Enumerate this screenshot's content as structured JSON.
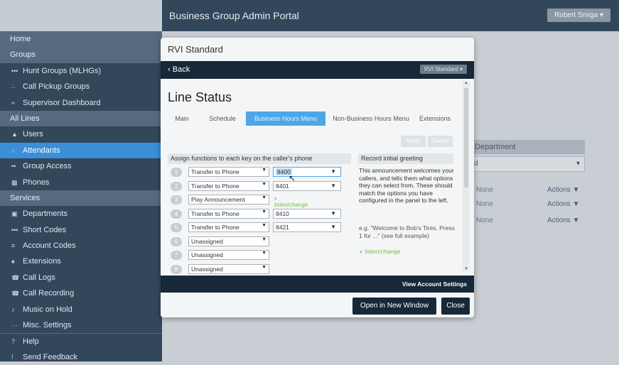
{
  "topbar": {
    "title": "Business Group Admin Portal",
    "user": "Robert Smiga ▾"
  },
  "sidebar": {
    "items": [
      {
        "label": "Home",
        "type": "hdr",
        "icon": ""
      },
      {
        "label": "Groups",
        "type": "hdr",
        "icon": ""
      },
      {
        "label": "Hunt Groups (MLHGs)",
        "type": "item",
        "icon": "•••"
      },
      {
        "label": "Call Pickup Groups",
        "type": "item",
        "icon": "∴"
      },
      {
        "label": "Supervisor Dashboard",
        "type": "item",
        "icon": "≈"
      },
      {
        "label": "All Lines",
        "type": "hdr",
        "icon": ""
      },
      {
        "label": "Users",
        "type": "item",
        "icon": "▲"
      },
      {
        "label": "Attendants",
        "type": "active",
        "icon": "○"
      },
      {
        "label": "Group Access",
        "type": "item",
        "icon": "••"
      },
      {
        "label": "Phones",
        "type": "item",
        "icon": "▦"
      },
      {
        "label": "Services",
        "type": "hdr",
        "icon": ""
      },
      {
        "label": "Departments",
        "type": "item",
        "icon": "▣"
      },
      {
        "label": "Short Codes",
        "type": "item",
        "icon": "•••"
      },
      {
        "label": "Account Codes",
        "type": "item",
        "icon": "≡"
      },
      {
        "label": "Extensions",
        "type": "item",
        "icon": "♠"
      },
      {
        "label": "Call Logs",
        "type": "item",
        "icon": "☎"
      },
      {
        "label": "Call Recording",
        "type": "item",
        "icon": "☎"
      },
      {
        "label": "Music on Hold",
        "type": "item",
        "icon": "♪"
      },
      {
        "label": "Misc. Settings",
        "type": "item",
        "icon": "···"
      },
      {
        "label": "Help",
        "type": "help",
        "icon": "?"
      },
      {
        "label": "Send Feedback",
        "type": "item",
        "icon": "!"
      }
    ]
  },
  "background": {
    "department_header": "Department",
    "department_select": "d",
    "rows": [
      {
        "value": "None",
        "action": "Actions ▼"
      },
      {
        "value": "None",
        "action": "Actions ▼"
      },
      {
        "value": "None",
        "action": "Actions ▼"
      }
    ]
  },
  "modal": {
    "title": "RVI Standard",
    "back": "Back",
    "selector": "RVI Standard ▾",
    "heading": "Line Status",
    "tabs": [
      {
        "label": "Main",
        "active": false
      },
      {
        "label": "Schedule",
        "active": false
      },
      {
        "label": "Business Hours Menu",
        "active": true
      },
      {
        "label": "Non-Business Hours Menu",
        "active": false
      },
      {
        "label": "Extensions",
        "active": false
      }
    ],
    "apply": "Apply",
    "cancel": "Cancel",
    "assign_header": "Assign functions to each key on the caller's phone",
    "greeting_header": "Record initial greeting",
    "keys": [
      {
        "num": "1",
        "function": "Transfer to Phone",
        "target": "8400",
        "listen": ""
      },
      {
        "num": "2",
        "function": "Transfer to Phone",
        "target": "8401",
        "listen": ""
      },
      {
        "num": "3",
        "function": "Play Announcement",
        "target": "",
        "listen": "listen/change"
      },
      {
        "num": "4",
        "function": "Transfer to Phone",
        "target": "8410",
        "listen": ""
      },
      {
        "num": "5",
        "function": "Transfer to Phone",
        "target": "8421",
        "listen": ""
      },
      {
        "num": "6",
        "function": "Unassigned",
        "target": "",
        "listen": ""
      },
      {
        "num": "7",
        "function": "Unassigned",
        "target": "",
        "listen": ""
      },
      {
        "num": "8",
        "function": "Unassigned",
        "target": "",
        "listen": ""
      }
    ],
    "greeting_text": "This announcement welcomes your callers, and tells them what options they can select from. These should match the options you have configured in the panel to the left.",
    "greeting_example": "e.g. \"Welcome to Bob's Tires. Press 1 for ...\" (see full example)",
    "greeting_listen": "listen/change",
    "view_account": "View Account Settings",
    "open_new_window": "Open in New Window",
    "close": "Close"
  }
}
